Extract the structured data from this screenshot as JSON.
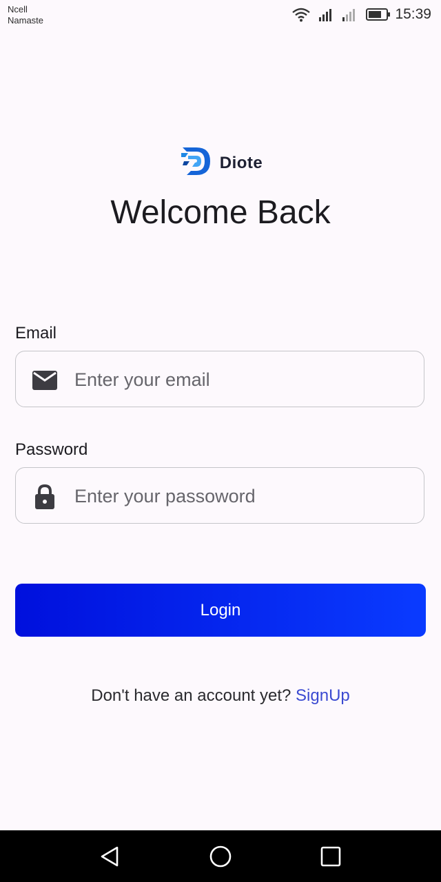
{
  "status_bar": {
    "carrier_line1": "Ncell",
    "carrier_line2": "Namaste",
    "time": "15:39",
    "icons": [
      "wifi-icon",
      "signal-icon",
      "signal-weak-icon",
      "battery-icon"
    ]
  },
  "brand": {
    "name": "Diote",
    "logo_icon": "diote-logo-icon"
  },
  "header": {
    "title": "Welcome Back"
  },
  "form": {
    "email": {
      "label": "Email",
      "placeholder": "Enter your email",
      "value": "",
      "icon": "mail-icon"
    },
    "password": {
      "label": "Password",
      "placeholder": "Enter your passoword",
      "value": "",
      "icon": "lock-icon"
    },
    "login_label": "Login"
  },
  "signup": {
    "prompt": "Don't have an account yet?",
    "link_label": "SignUp"
  },
  "nav_bar": {
    "icons": [
      "back-icon",
      "home-icon",
      "recent-apps-icon"
    ]
  },
  "colors": {
    "background": "#fdf9fd",
    "button_start": "#0010dd",
    "button_end": "#0a3bff",
    "link": "#3b4ad1",
    "logo_blue": "#1565d8"
  }
}
